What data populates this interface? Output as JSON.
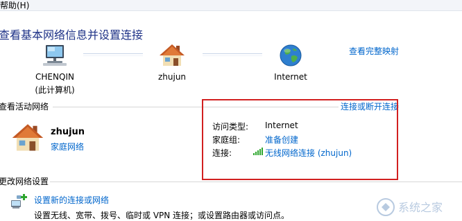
{
  "menubar": {
    "help": "帮助(H)"
  },
  "page_title": "查看基本网络信息并设置连接",
  "map_link": "查看完整映射",
  "network_map": {
    "nodes": [
      {
        "name": "CHENQIN",
        "sub": "(此计算机)",
        "icon": "computer-icon"
      },
      {
        "name": "zhujun",
        "sub": "",
        "icon": "house-icon"
      },
      {
        "name": "Internet",
        "sub": "",
        "icon": "globe-icon"
      }
    ]
  },
  "active_networks": {
    "header": "查看活动网络",
    "connect_link": "连接或断开连接",
    "network_name": "zhujun",
    "network_type": "家庭网络",
    "access_type_label": "访问类型:",
    "access_type_value": "Internet",
    "homegroup_label": "家庭组:",
    "homegroup_value": "准备创建",
    "connection_label": "连接:",
    "connection_value": "无线网络连接 (zhujun)"
  },
  "change_settings": {
    "header": "更改网络设置",
    "setup_link": "设置新的连接或网络",
    "setup_desc": "设置无线、宽带、拨号、临时或 VPN 连接；或设置路由器或访问点。"
  },
  "watermark_text": "系统之家",
  "colors": {
    "title": "#1e3287",
    "link": "#0066cc",
    "highlight_box": "#d22020"
  }
}
